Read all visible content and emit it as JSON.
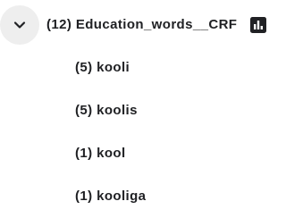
{
  "tree": {
    "parent": {
      "label": "(12) Education_words__CRF",
      "expanded": true,
      "toggle_icon": "chevron-down-icon",
      "action_icon": "bar-chart-icon"
    },
    "children": [
      {
        "label": "(5) kooli"
      },
      {
        "label": "(5) koolis"
      },
      {
        "label": "(1) kool"
      },
      {
        "label": "(1) kooliga"
      }
    ]
  },
  "colors": {
    "text": "#202124",
    "toggle_bg": "#eeeeee",
    "icon": "#202124"
  }
}
